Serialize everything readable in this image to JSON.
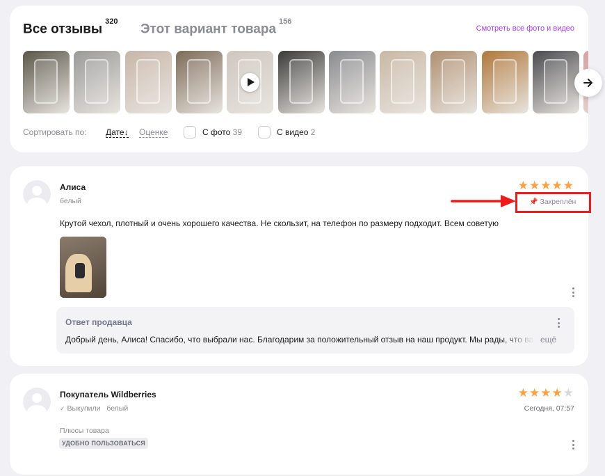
{
  "tabs": {
    "all_label": "Все отзывы",
    "all_count": "320",
    "variant_label": "Этот вариант товара",
    "variant_count": "156"
  },
  "see_all_link": "Смотреть все фото и видео",
  "gallery": {
    "next_icon": "arrow-right-icon",
    "thumbs": [
      {
        "kind": "photo",
        "bg": "#5b5648"
      },
      {
        "kind": "photo",
        "bg": "#9a9a98"
      },
      {
        "kind": "photo",
        "bg": "#c8b6a8"
      },
      {
        "kind": "photo",
        "bg": "#7d6b58"
      },
      {
        "kind": "video",
        "bg": "#cfc6bf"
      },
      {
        "kind": "photo",
        "bg": "#3a3a38"
      },
      {
        "kind": "photo",
        "bg": "#8a8b8f"
      },
      {
        "kind": "photo",
        "bg": "#c9b8a4"
      },
      {
        "kind": "photo",
        "bg": "#b09070"
      },
      {
        "kind": "photo",
        "bg": "#b0783a"
      },
      {
        "kind": "photo",
        "bg": "#4a4a4e"
      },
      {
        "kind": "photo",
        "bg": "#d8a0a0"
      }
    ]
  },
  "sort": {
    "label": "Сортировать по:",
    "by_date": "Дате",
    "by_date_arrow": "↓",
    "by_rating": "Оценке",
    "with_photo_label": "С фото",
    "with_photo_count": "39",
    "with_video_label": "С видео",
    "with_video_count": "2"
  },
  "review1": {
    "author": "Алиса",
    "variant": "белый",
    "rating": 5,
    "pinned_label": "Закреплён",
    "text": "Крутой чехол, плотный и очень хорошего качества. Не скользит, на телефон по размеру подходит. Всем советую",
    "seller_reply_title": "Ответ продавца",
    "seller_reply_text": "Добрый день, Алиса! Спасибо, что выбрали нас. Благодарим за положительный отзыв на наш продукт. Мы рады, что вам понравился",
    "seller_reply_more": "ещё"
  },
  "review2": {
    "author": "Покупатель Wildberries",
    "bought_label": "Выкупили",
    "variant": "белый",
    "rating": 4,
    "date": "Сегодня, 07:57",
    "pros_label": "Плюсы товара",
    "pros_tag": "УДОБНО ПОЛЬЗОВАТЬСЯ"
  },
  "colors": {
    "accent": "#a73afd",
    "star": "#ff9f40",
    "highlight_red": "#ef1a1a"
  }
}
